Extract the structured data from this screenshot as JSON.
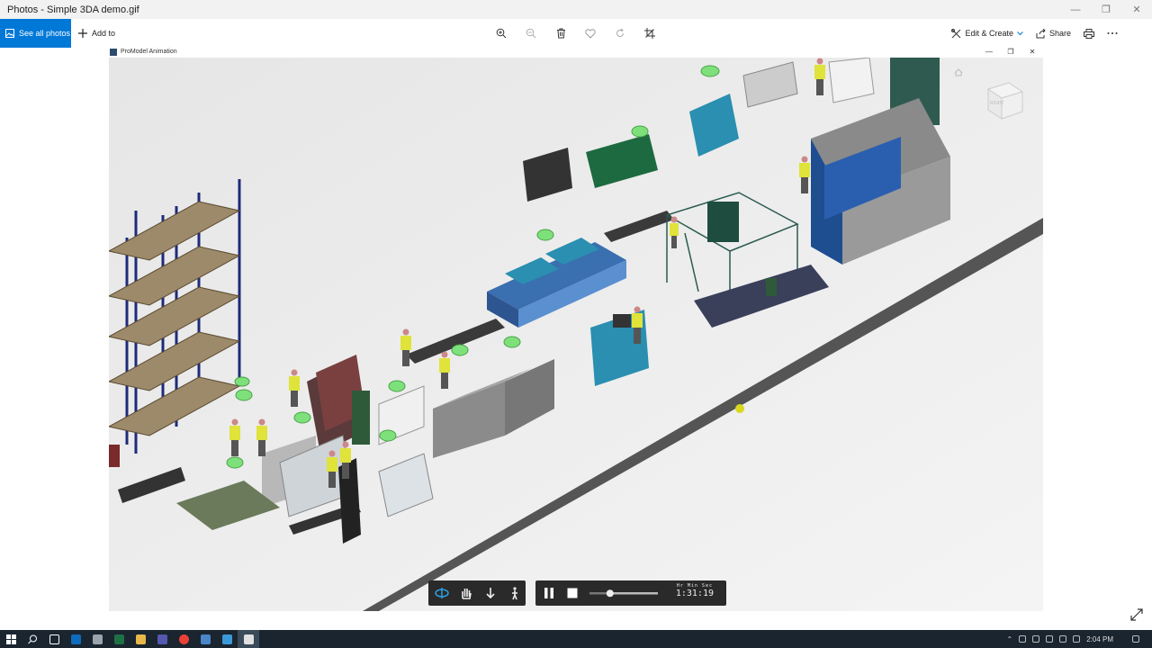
{
  "window": {
    "title": "Photos - Simple 3DA demo.gif",
    "controls": [
      "—",
      "❐",
      "✕"
    ]
  },
  "toolbar": {
    "see_all_photos": "See all photos",
    "add_to": "Add to",
    "edit_create": "Edit & Create",
    "share": "Share"
  },
  "viewer": {
    "inner_title": "ProModel Animation",
    "inner_controls": [
      "—",
      "❐",
      "✕"
    ],
    "view_cube_label": "RIGHT"
  },
  "playback": {
    "time_labels": "Hr  Min  Sec",
    "time_value": "1:31:19",
    "progress": 0.3
  },
  "taskbar": {
    "clock": "2:04 PM",
    "apps": [
      "start",
      "search",
      "task-view",
      "outlook",
      "file-explorer",
      "excel",
      "folder",
      "teams",
      "chrome",
      "app",
      "photos",
      "promodel"
    ]
  },
  "colors": {
    "accent": "#0078d7",
    "worker_shirt": "#dfe33a",
    "machine_teal": "#2a8fb0",
    "rack_blue": "#1e2a7a",
    "green_part": "#7ee07a"
  }
}
